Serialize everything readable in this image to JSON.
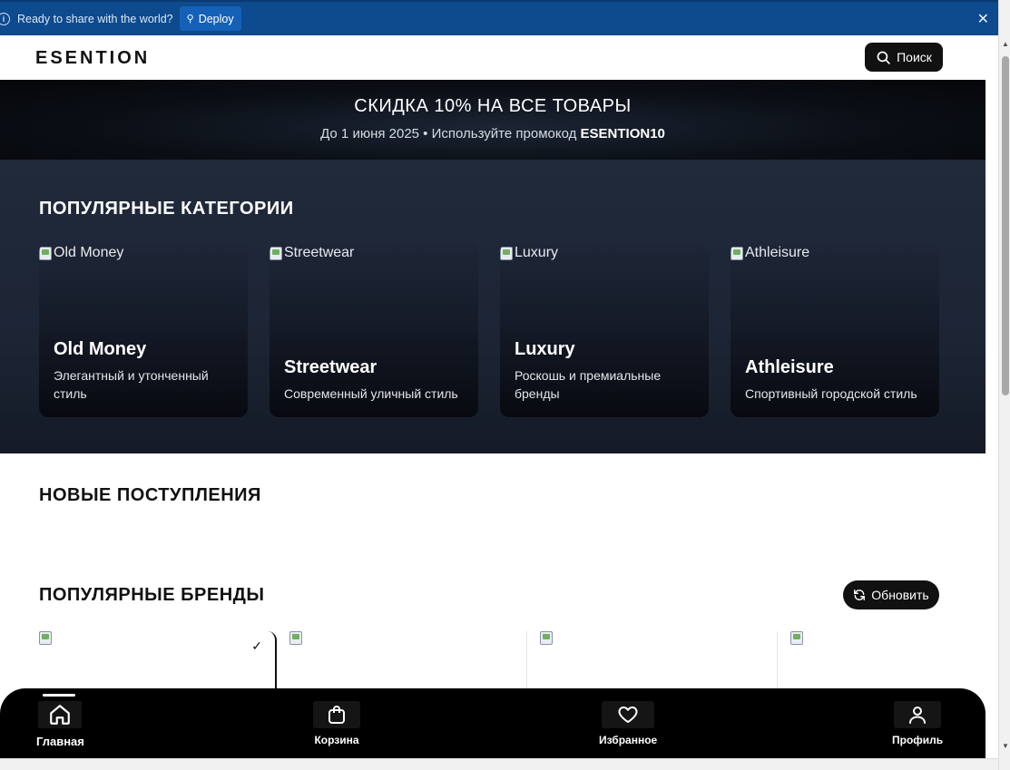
{
  "deploy_bar": {
    "message": "Ready to share with the world?",
    "deploy_label": "Deploy"
  },
  "header": {
    "logo": "ESENTION",
    "search_label": "Поиск"
  },
  "promo": {
    "title": "СКИДКА 10% НА ВСЕ ТОВАРЫ",
    "subtitle_prefix": "До 1 июня 2025 • Используйте промокод ",
    "promo_code": "ESENTION10"
  },
  "categories": {
    "title": "ПОПУЛЯРНЫЕ КАТЕГОРИИ",
    "items": [
      {
        "alt": "Old Money",
        "name": "Old Money",
        "desc": "Элегантный и утонченный стиль"
      },
      {
        "alt": "Streetwear",
        "name": "Streetwear",
        "desc": "Современный уличный стиль"
      },
      {
        "alt": "Luxury",
        "name": "Luxury",
        "desc": "Роскошь и премиальные бренды"
      },
      {
        "alt": "Athleisure",
        "name": "Athleisure",
        "desc": "Спортивный городской стиль"
      }
    ]
  },
  "new_arrivals": {
    "title": "НОВЫЕ ПОСТУПЛЕНИЯ"
  },
  "brands": {
    "title": "ПОПУЛЯРНЫЕ БРЕНДЫ",
    "refresh_label": "Обновить",
    "selected_mark": "✓"
  },
  "bottom_nav": {
    "items": [
      {
        "label": "Главная",
        "icon": "home-icon"
      },
      {
        "label": "Корзина",
        "icon": "bag-icon"
      },
      {
        "label": "Избранное",
        "icon": "heart-icon"
      },
      {
        "label": "Профиль",
        "icon": "user-icon"
      }
    ]
  }
}
